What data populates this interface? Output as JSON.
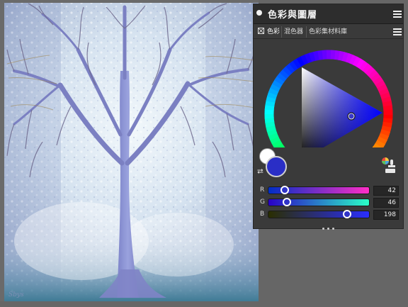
{
  "panel": {
    "title": "色彩與圖層",
    "tabs": [
      {
        "label": "色彩",
        "active": true
      },
      {
        "label": "混色器",
        "active": false
      },
      {
        "label": "色彩集材料庫",
        "active": false
      }
    ]
  },
  "color": {
    "sliders": [
      {
        "label": "R",
        "value": "42",
        "fraction": 0.165
      },
      {
        "label": "G",
        "value": "46",
        "fraction": 0.18
      },
      {
        "label": "B",
        "value": "198",
        "fraction": 0.78
      }
    ],
    "main_color": "#2a2ec6",
    "sub_color": "#ffffff"
  },
  "icons": {
    "panel_dot": "circle-dot-icon",
    "menu": "hamburger-menu-icon",
    "tab_close": "close-box-icon",
    "swap": "swap-arrows-icon",
    "picker": "eyedropper-stamp-icon",
    "more": "more-dots-icon"
  }
}
